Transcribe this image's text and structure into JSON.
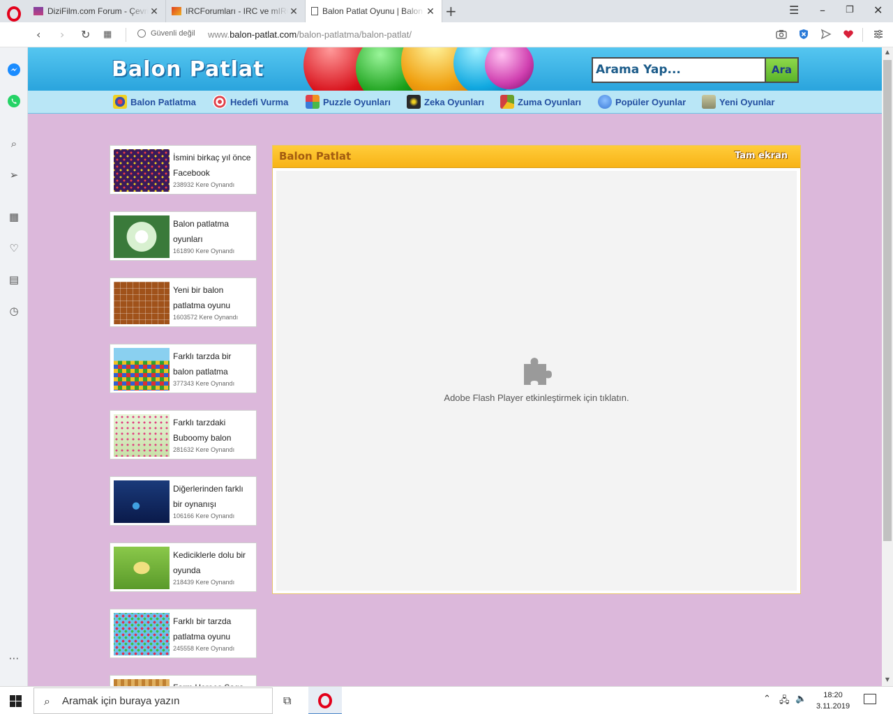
{
  "browser": {
    "tabs": [
      {
        "label": "DiziFilm.com Forum - Çevrimiçi",
        "close": "✕"
      },
      {
        "label": "IRCForumları - IRC ve mIRC Forumu",
        "close": "✕"
      },
      {
        "label": "Balon Patlat Oyunu | Balon Patlatma",
        "close": "✕"
      }
    ],
    "new_tab": "+",
    "security_label": "Güvenli değil",
    "url_prefix": "www.",
    "url_host": "balon-patlat.com",
    "url_path": "/balon-patlatma/balon-patlat/"
  },
  "site": {
    "logo": "Balon Patlat",
    "search_placeholder": "Arama Yap...",
    "search_button": "Ara",
    "categories": [
      {
        "label": "Balon Patlatma",
        "color": "#3b4fa8"
      },
      {
        "label": "Hedefi Vurma",
        "color": "#e0404a"
      },
      {
        "label": "Puzzle Oyunları",
        "color": "#f09020"
      },
      {
        "label": "Zeka Oyunları",
        "color": "#2a2a2a"
      },
      {
        "label": "Zuma Oyunları",
        "color": "#6aa02a"
      },
      {
        "label": "Popüler Oyunlar",
        "color": "#3a7ad8"
      },
      {
        "label": "Yeni Oyunlar",
        "color": "#8a8a6a"
      }
    ],
    "games": [
      {
        "title": "İsmini birkaç yıl önce Facebook",
        "plays": "238932 Kere Oynandı"
      },
      {
        "title": "Balon patlatma oyunları",
        "plays": "161890 Kere Oynandı"
      },
      {
        "title": "Yeni bir balon patlatma oyunu",
        "plays": "1603572 Kere Oynandı"
      },
      {
        "title": "Farklı tarzda bir balon patlatma",
        "plays": "377343 Kere Oynandı"
      },
      {
        "title": "Farklı tarzdaki Buboomy balon",
        "plays": "281632 Kere Oynandı"
      },
      {
        "title": "Diğerlerinden farklı bir oynanışı",
        "plays": "106166 Kere Oynandı"
      },
      {
        "title": "Kediciklerle dolu bir oyunda",
        "plays": "218439 Kere Oynandı"
      },
      {
        "title": "Farklı bir tarzda patlatma oyunu",
        "plays": "245558 Kere Oynandı"
      },
      {
        "title": "Farm Heroes Saga",
        "plays": ""
      }
    ],
    "panel_title": "Balon Patlat",
    "panel_fullscreen": "Tam ekran",
    "flash_message": "Adobe Flash Player etkinleştirmek için tıklatın."
  },
  "taskbar": {
    "search_placeholder": "Aramak için buraya yazın",
    "time": "18:20",
    "date": "3.11.2019"
  }
}
